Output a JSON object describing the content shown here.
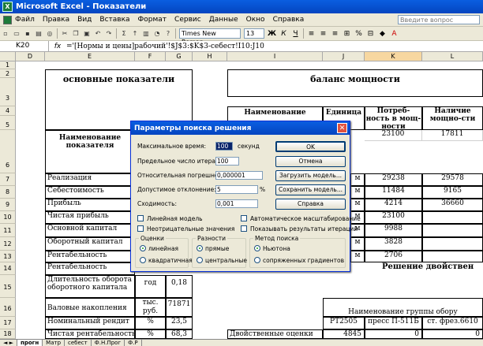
{
  "app": {
    "title": "Microsoft Excel - Показатели"
  },
  "menu": {
    "items": [
      "Файл",
      "Правка",
      "Вид",
      "Вставка",
      "Формат",
      "Сервис",
      "Данные",
      "Окно",
      "Справка"
    ],
    "help_placeholder": "Введите вопрос"
  },
  "toolbar": {
    "font": "Times New Roman",
    "size": "13",
    "bold": "Ж",
    "italic": "К",
    "underline": "Ч",
    "zoom": "%"
  },
  "formula_bar": {
    "cell_ref": "K20",
    "fx": "fx",
    "formula": "='[Нормы и цены]рабочий'!$J$3:$K$3-себест!I10:J10"
  },
  "columns": [
    {
      "label": "D"
    },
    {
      "label": "E"
    },
    {
      "label": "F"
    },
    {
      "label": "G"
    },
    {
      "label": "H"
    },
    {
      "label": "I"
    },
    {
      "label": "J"
    },
    {
      "label": "K"
    },
    {
      "label": "L"
    }
  ],
  "rows": [
    "1",
    "2",
    "3",
    "4",
    "5",
    "6",
    "7",
    "8",
    "9",
    "10",
    "11",
    "12",
    "13",
    "14",
    "15",
    "16",
    "17",
    "18"
  ],
  "sheet": {
    "basic_header": "основные показатели",
    "power_header": "баланс мощности",
    "col_name": "Наименование показателя",
    "col_name_short": "Наименование",
    "col_unit": "Единица",
    "col_need": "Потреб-ность в мощ-ности",
    "col_avail": "Наличие мощно-сти",
    "r7": "Реализация",
    "r8": "Себестоимость",
    "r9": "Прибыль",
    "r10": "Чистая прибыль",
    "r11": "Основной капитал",
    "r12": "Оборотный капитал",
    "r13": "Рентабельность",
    "r14": "Рентабельность",
    "r15": "Длительность оборота оборотного капитала",
    "r15_unit": "год",
    "r15_val": "0,18",
    "r16": "Валовые накопления",
    "r16_unit": "тыс. руб.",
    "r16_val": "71871",
    "r17": "Номинальный рендит",
    "r17_unit": "%",
    "r17_val": "23,5",
    "r18": "Чистая рентабельность",
    "r18_unit": "%",
    "r18_val": "68,3",
    "k5": "23100",
    "l5": "17811",
    "k7": "29238",
    "l7": "29578",
    "k8": "11484",
    "l8": "9165",
    "k9": "4214",
    "l9": "36660",
    "k10": "23100",
    "k11": "9988",
    "k12": "3828",
    "k13": "2706",
    "solution_header": "Решение двойствен",
    "group_name": "Наименование группы обору",
    "rt": "РТ2505",
    "press": "пресс П-511Б",
    "frez": "ст. фрез.6610",
    "ст": "ст",
    "dual": "Двойственные оценки",
    "dual_val": "4845",
    "zero1": "0",
    "zero2": "0",
    "j7": "м",
    "j8": "м",
    "j9": "м",
    "j10": "м",
    "j11": "м",
    "j12": "м",
    "j13": "м"
  },
  "tabs": [
    "прогн",
    "Матр",
    "себест",
    "Ф.Н.Прог",
    "Ф.Р"
  ],
  "dialog": {
    "title": "Параметры поиска решения",
    "max_time_label": "Максимальное время:",
    "max_time": "100",
    "seconds": "секунд",
    "iter_label": "Предельное число итераций:",
    "iter": "100",
    "precision_label": "Относительная погрешность:",
    "precision": "0,000001",
    "tolerance_label": "Допустимое отклонение:",
    "tolerance": "5",
    "percent": "%",
    "convergence_label": "Сходимость:",
    "convergence": "0,001",
    "ok": "OK",
    "cancel": "Отмена",
    "load": "Загрузить модель...",
    "save": "Сохранить модель...",
    "help": "Справка",
    "linear": "Линейная модель",
    "nonneg": "Неотрицательные значения",
    "autoscale": "Автоматическое масштабирование",
    "show_iter": "Показывать результаты итераций",
    "est_group": "Оценки",
    "diff_group": "Разности",
    "method_group": "Метод поиска",
    "est_linear": "линейная",
    "est_quad": "квадратичная",
    "diff_forward": "прямые",
    "diff_central": "центральные",
    "method_newton": "Ньютона",
    "method_cg": "сопряженных градиентов"
  }
}
